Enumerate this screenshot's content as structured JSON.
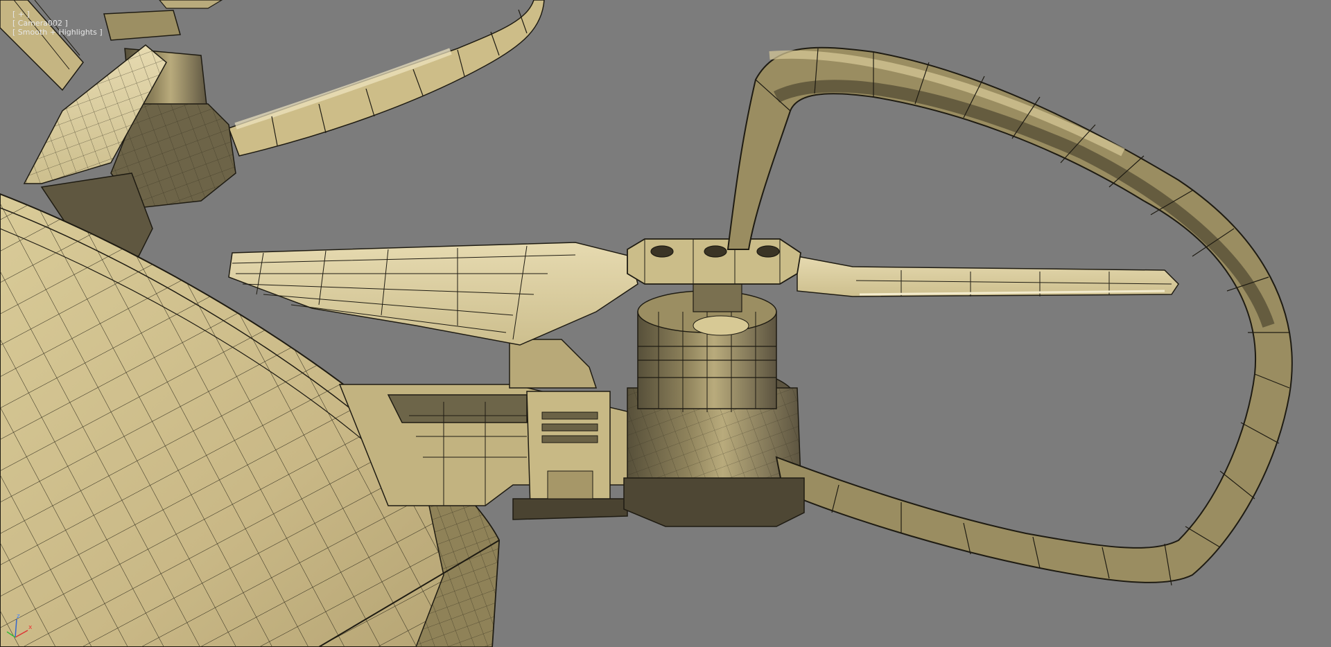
{
  "viewport": {
    "menus": {
      "plus": "[ + ]",
      "view": "[ Camera002 ]",
      "shading": "[ Smooth + Highlights ]"
    },
    "axis_labels": {
      "x": "x",
      "z": "z"
    },
    "colors": {
      "background": "#7c7c7c",
      "mesh_light": "#e2d6a6",
      "mesh_mid": "#b2a474",
      "mesh_dark": "#4a4331",
      "wire": "#1e1b12"
    }
  }
}
